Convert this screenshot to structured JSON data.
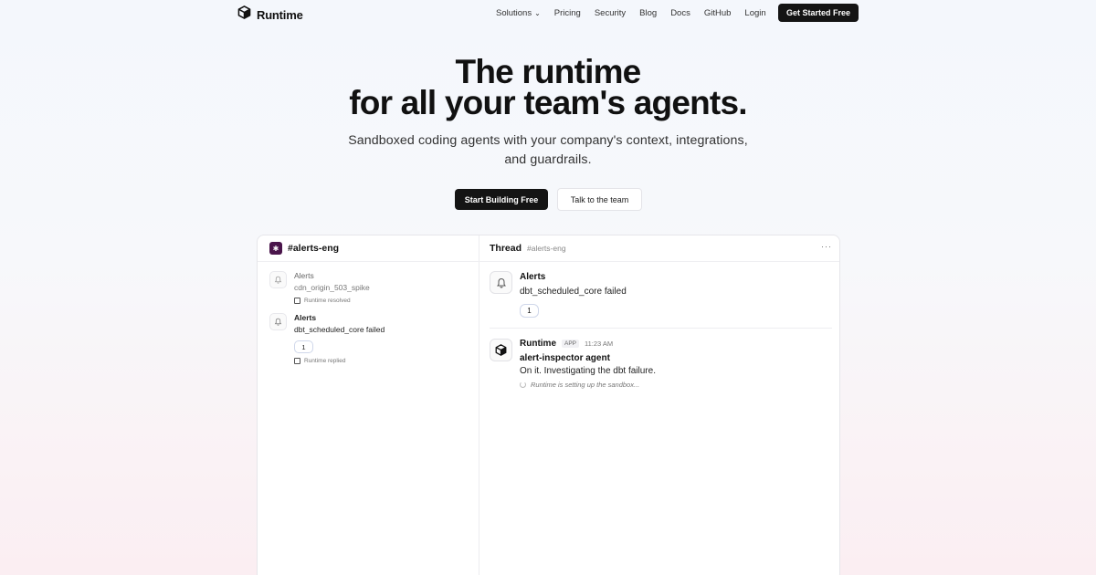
{
  "nav": {
    "brand": "Runtime",
    "links": [
      "Solutions",
      "Pricing",
      "Security",
      "Blog",
      "Docs",
      "GitHub",
      "Login"
    ],
    "cta": "Get Started Free"
  },
  "hero": {
    "title_line1": "The runtime",
    "title_line2": "for all your team's agents.",
    "subtitle_line1": "Sandboxed coding agents with your company's context, integrations,",
    "subtitle_line2": "and guardrails.",
    "primary_button": "Start Building Free",
    "secondary_button": "Talk to the team"
  },
  "demo": {
    "channel": "#alerts-eng",
    "left_messages": [
      {
        "sender": "Alerts",
        "text": "cdn_origin_503_spike",
        "footer": "Runtime resolved"
      },
      {
        "sender": "Alerts",
        "text": "dbt_scheduled_core failed",
        "badge": "1",
        "footer": "Runtime replied"
      }
    ],
    "thread": {
      "title": "Thread",
      "channel": "#alerts-eng",
      "alert_sender": "Alerts",
      "alert_text": "dbt_scheduled_core failed",
      "alert_badge": "1",
      "reply_sender": "Runtime",
      "reply_tag": "APP",
      "reply_time": "11:23 AM",
      "reply_title": "alert-inspector agent",
      "reply_text": "On it. Investigating the dbt failure.",
      "reply_status": "Runtime is setting up the sandbox..."
    }
  },
  "colors": {
    "primary_button": "#141414",
    "slack_purple": "#4a154b"
  }
}
